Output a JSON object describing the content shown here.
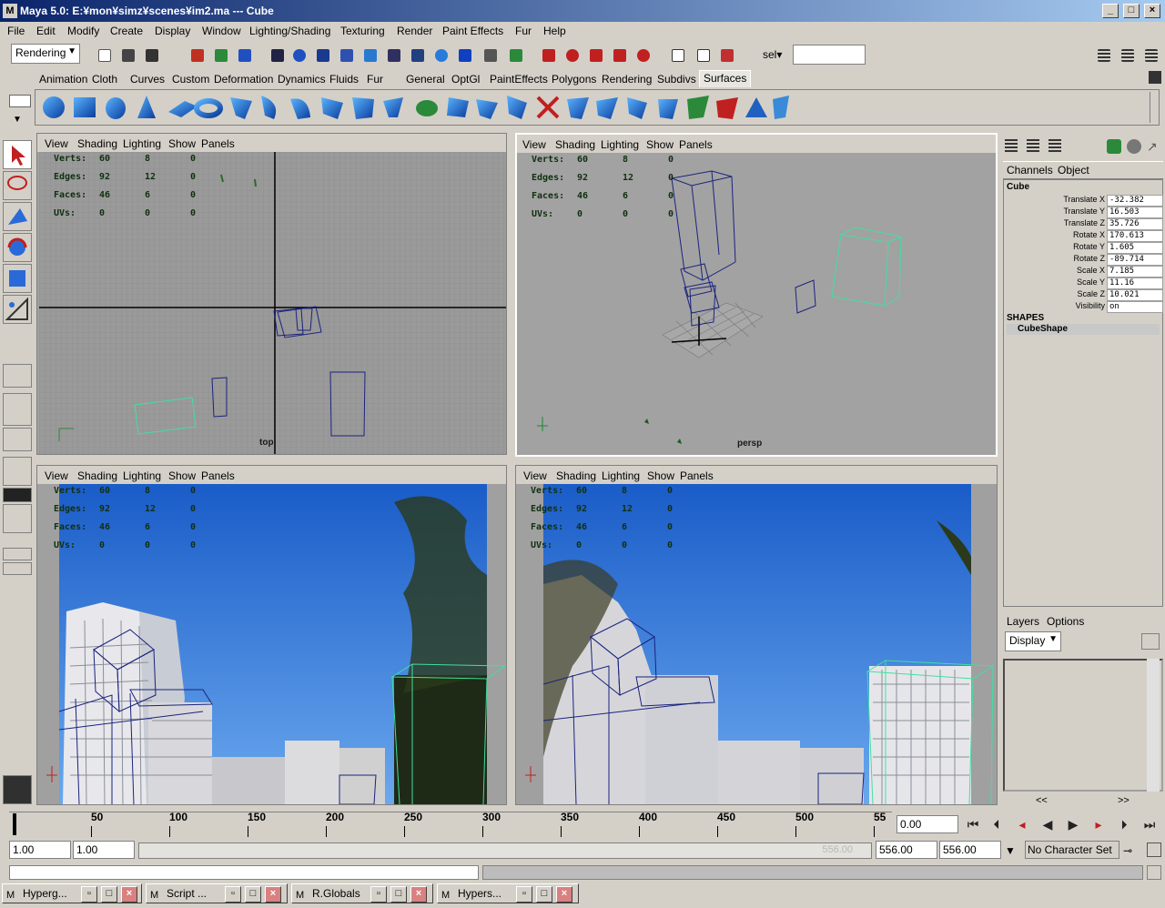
{
  "window": {
    "title": "Maya 5.0: E:¥mon¥simz¥scenes¥im2.ma    ---    Cube",
    "logo": "M",
    "min": "_",
    "max": "□",
    "close": "×"
  },
  "menu": [
    "File",
    "Edit",
    "Modify",
    "Create",
    "Display",
    "Window",
    "Lighting/Shading",
    "Texturing",
    "Render",
    "Paint Effects",
    "Fur",
    "Help"
  ],
  "status": {
    "menuset": "Rendering",
    "sel_label": "sel▾",
    "sel_value": ""
  },
  "shelf_tabs": [
    "Animation",
    "Cloth",
    "Curves",
    "Custom",
    "Deformation",
    "Dynamics",
    "Fluids",
    "Fur",
    "General",
    "OptGl",
    "PaintEffects",
    "Polygons",
    "Rendering",
    "Subdivs",
    "Surfaces"
  ],
  "viewports": {
    "menu": [
      "View",
      "Shading",
      "Lighting",
      "Show",
      "Panels"
    ],
    "hud": {
      "labels": [
        "Verts:",
        "Edges:",
        "Faces:",
        "UVs:"
      ],
      "col1": [
        "60",
        "92",
        "46",
        "0"
      ],
      "col2": [
        "8",
        "12",
        "6",
        "0"
      ],
      "col3": [
        "0",
        "0",
        "0",
        "0"
      ]
    },
    "top_label": "top",
    "persp_label": "persp"
  },
  "channelbox": {
    "tabs": [
      "Channels",
      "Object"
    ],
    "object": "Cube",
    "attrs": [
      {
        "n": "Translate X",
        "v": "-32.382"
      },
      {
        "n": "Translate Y",
        "v": "16.503"
      },
      {
        "n": "Translate Z",
        "v": "35.726"
      },
      {
        "n": "Rotate X",
        "v": "170.613"
      },
      {
        "n": "Rotate Y",
        "v": "1.605"
      },
      {
        "n": "Rotate Z",
        "v": "-89.714"
      },
      {
        "n": "Scale X",
        "v": "7.185"
      },
      {
        "n": "Scale Y",
        "v": "11.16"
      },
      {
        "n": "Scale Z",
        "v": "10.021"
      },
      {
        "n": "Visibility",
        "v": "on"
      }
    ],
    "shapes_header": "SHAPES",
    "shape": "CubeShape"
  },
  "layers": {
    "tabs": [
      "Layers",
      "Options"
    ],
    "mode": "Display",
    "nav_prev": "<<",
    "nav_next": ">>"
  },
  "timeline": {
    "ticks": [
      "50",
      "100",
      "150",
      "200",
      "250",
      "300",
      "350",
      "400",
      "450",
      "500",
      "55"
    ],
    "current": "0.00"
  },
  "range": {
    "start": "1.00",
    "start2": "1.00",
    "slider_end": "556.00",
    "end1": "556.00",
    "end2": "556.00",
    "charset": "No Character Set"
  },
  "taskbar": [
    {
      "label": "Hyperg..."
    },
    {
      "label": "Script ..."
    },
    {
      "label": "R.Globals"
    },
    {
      "label": "Hypers..."
    }
  ],
  "colors": {
    "accent": "#0a246a",
    "wire_sel": "#40e0a0",
    "wire": "#1a237e",
    "sky": "#2f7ad8"
  }
}
